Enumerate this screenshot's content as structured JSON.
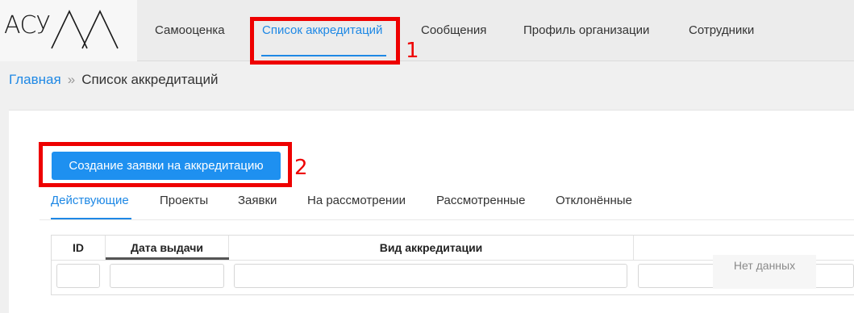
{
  "app": {
    "logo_text": "АСУ",
    "logo_suffix": "ЛА"
  },
  "nav": {
    "items": [
      {
        "label": "Самооценка"
      },
      {
        "label": "Список аккредитаций"
      },
      {
        "label": "Сообщения"
      },
      {
        "label": "Профиль организации"
      },
      {
        "label": "Сотрудники"
      }
    ],
    "active": "Список аккредитаций"
  },
  "annotations": [
    {
      "number": "1"
    },
    {
      "number": "2"
    }
  ],
  "breadcrumb": {
    "home": "Главная",
    "separator": "»",
    "current": "Список аккредитаций"
  },
  "actions": {
    "create_label": "Создание заявки на аккредитацию"
  },
  "tabs": {
    "items": [
      {
        "label": "Действующие"
      },
      {
        "label": "Проекты"
      },
      {
        "label": "Заявки"
      },
      {
        "label": "На рассмотрении"
      },
      {
        "label": "Рассмотренные"
      },
      {
        "label": "Отклонённые"
      }
    ],
    "active": "Действующие"
  },
  "table": {
    "columns": [
      "ID",
      "Дата выдачи",
      "Вид аккредитации",
      ""
    ],
    "empty_text": "Нет данных"
  },
  "colors": {
    "accent": "#1e88e5",
    "button": "#1e90f0",
    "annotation": "#ee0000"
  }
}
